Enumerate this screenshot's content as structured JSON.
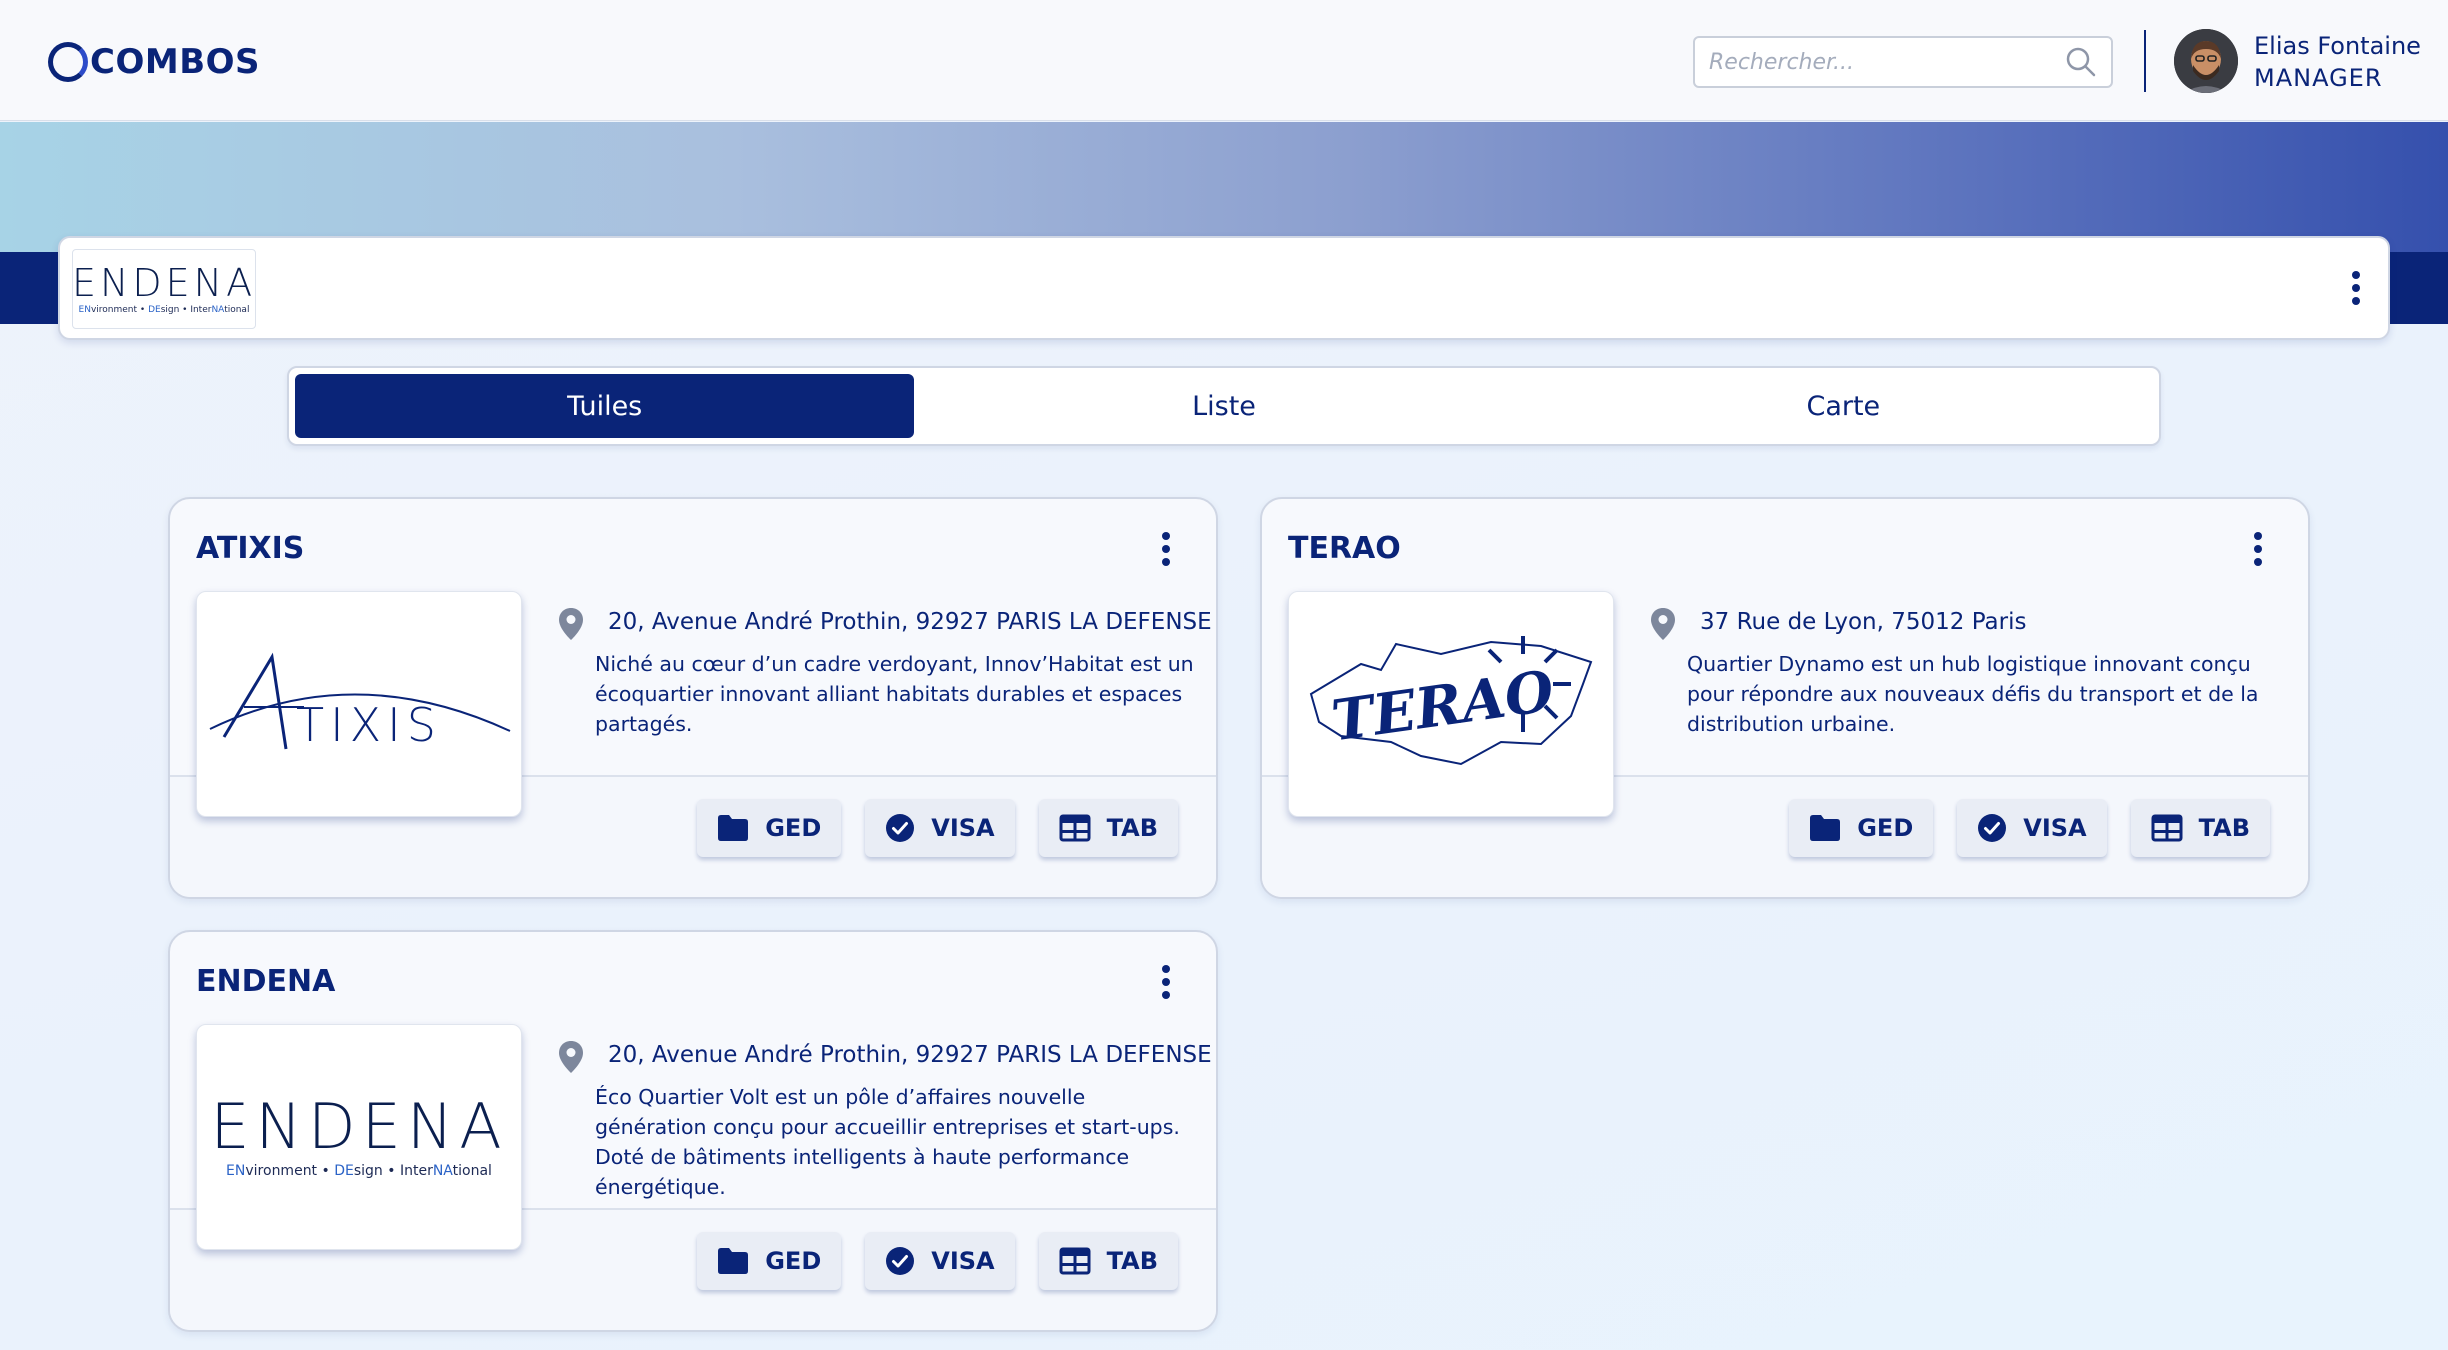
{
  "header": {
    "brand": "COMBOS",
    "search_placeholder": "Rechercher...",
    "user_name": "Elias Fontaine",
    "user_role": "MANAGER"
  },
  "org": {
    "logo_word": "ENDENA",
    "logo_sub": [
      "EN",
      "vironment • ",
      "DE",
      "sign • Inter",
      "NA",
      "tional"
    ]
  },
  "tabs": [
    {
      "label": "Tuiles",
      "active": true
    },
    {
      "label": "Liste",
      "active": false
    },
    {
      "label": "Carte",
      "active": false
    }
  ],
  "actions": {
    "ged": "GED",
    "visa": "VISA",
    "tab": "TAB"
  },
  "cards": [
    {
      "title": "ATIXIS",
      "logo_text": "TIXIS",
      "address": "20, Avenue André Prothin, 92927 PARIS LA DEFENSE",
      "description": "Niché au cœur d’un cadre verdoyant, Innov’Habitat est un écoquartier innovant alliant habitats durables et espaces partagés."
    },
    {
      "title": "TERAO",
      "logo_text": "TERAO",
      "address": "37 Rue de Lyon, 75012 Paris",
      "description": "Quartier Dynamo est un hub logistique innovant conçu pour répondre aux nouveaux défis du transport et de la distribution urbaine."
    },
    {
      "title": "ENDENA",
      "logo_text": "ENDENA",
      "address": "20, Avenue André Prothin, 92927 PARIS LA DEFENSE",
      "description": "Éco Quartier Volt est un pôle d’affaires nouvelle génération conçu pour accueillir entreprises et start-ups. Doté de bâtiments intelligents à haute performance énergétique."
    }
  ],
  "colors": {
    "primary": "#0a2478",
    "accent": "#2b63c7"
  }
}
